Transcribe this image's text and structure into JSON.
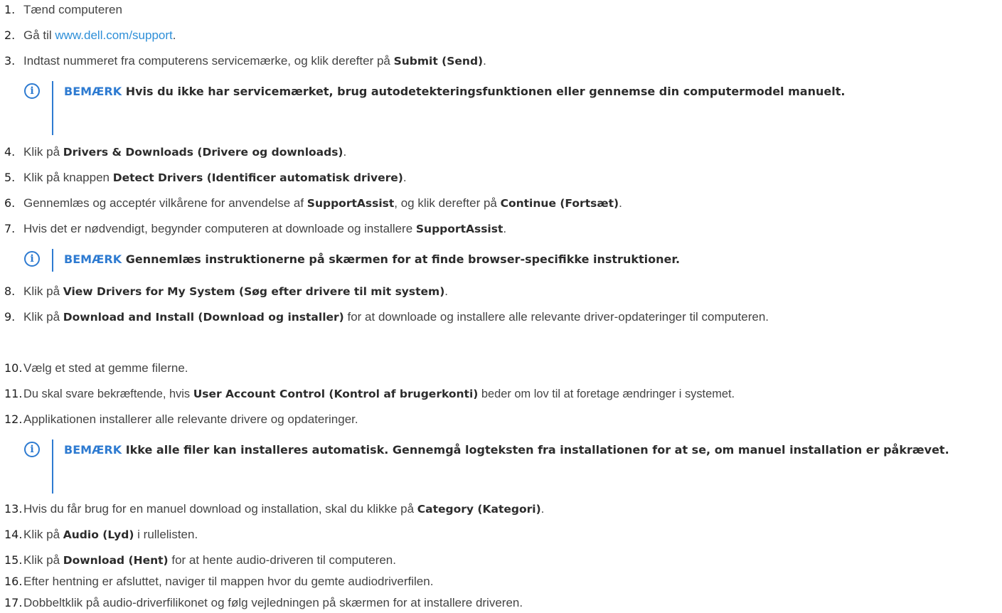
{
  "steps": [
    {
      "num": "1.",
      "parts": [
        {
          "t": "Tænd computeren"
        }
      ]
    },
    {
      "num": "2.",
      "parts": [
        {
          "t": "Gå til "
        },
        {
          "t": "www.dell.com/support",
          "link": true
        },
        {
          "t": "."
        }
      ]
    },
    {
      "num": "3.",
      "parts": [
        {
          "t": "Indtast nummeret fra computerens servicemærke, og klik derefter på "
        },
        {
          "t": "Submit (Send)",
          "b": true
        },
        {
          "t": "."
        }
      ]
    },
    {
      "num": "4.",
      "parts": [
        {
          "t": "Klik på "
        },
        {
          "t": "Drivers & Downloads (Drivere og downloads)",
          "b": true
        },
        {
          "t": "."
        }
      ]
    },
    {
      "num": "5.",
      "parts": [
        {
          "t": "Klik på knappen "
        },
        {
          "t": "Detect Drivers (Identificer automatisk drivere)",
          "b": true
        },
        {
          "t": "."
        }
      ]
    },
    {
      "num": "6.",
      "parts": [
        {
          "t": "Gennemlæs og acceptér vilkårene for anvendelse af "
        },
        {
          "t": "SupportAssist",
          "b": true
        },
        {
          "t": ", og klik derefter på "
        },
        {
          "t": "Continue (Fortsæt)",
          "b": true
        },
        {
          "t": "."
        }
      ]
    },
    {
      "num": "7.",
      "parts": [
        {
          "t": "Hvis det er nødvendigt, begynder computeren at downloade og installere "
        },
        {
          "t": "SupportAssist",
          "b": true
        },
        {
          "t": "."
        }
      ]
    },
    {
      "num": "8.",
      "parts": [
        {
          "t": "Klik på "
        },
        {
          "t": "View Drivers for My System (Søg efter drivere til mit system)",
          "b": true
        },
        {
          "t": "."
        }
      ]
    },
    {
      "num": "9.",
      "parts": [
        {
          "t": "Klik på "
        },
        {
          "t": "Download and Install (Download og installer)",
          "b": true
        },
        {
          "t": " for at downloade og installere alle relevante driver-opdateringer til computeren."
        }
      ]
    },
    {
      "num": "10.",
      "parts": [
        {
          "t": "Vælg et sted at gemme filerne."
        }
      ]
    },
    {
      "num": "11.",
      "parts": [
        {
          "t": "Du skal svare bekræftende, hvis "
        },
        {
          "t": "User Account Control (Kontrol af brugerkonti)",
          "b": true
        },
        {
          "t": " beder om lov til at foretage ændringer i systemet."
        }
      ]
    },
    {
      "num": "12.",
      "parts": [
        {
          "t": "Applikationen installerer alle relevante drivere og opdateringer."
        }
      ]
    },
    {
      "num": "13.",
      "parts": [
        {
          "t": "Hvis du får brug for en manuel download og installation, skal du klikke på "
        },
        {
          "t": "Category (Kategori)",
          "b": true
        },
        {
          "t": "."
        }
      ]
    },
    {
      "num": "14.",
      "parts": [
        {
          "t": "Klik på "
        },
        {
          "t": "Audio (Lyd)",
          "b": true
        },
        {
          "t": " i rullelisten."
        }
      ]
    },
    {
      "num": "15.",
      "parts": [
        {
          "t": "Klik på "
        },
        {
          "t": "Download (Hent)",
          "b": true
        },
        {
          "t": " for at hente audio-driveren til computeren."
        }
      ]
    },
    {
      "num": "16.",
      "parts": [
        {
          "t": "Efter hentning er afsluttet, naviger til mappen hvor du gemte audiodriverfilen."
        }
      ]
    },
    {
      "num": "17.",
      "parts": [
        {
          "t": "Dobbeltklik på audio-driverfilikonet og følg vejledningen på skærmen for at installere driveren."
        }
      ]
    }
  ],
  "notes": [
    {
      "icon": "i",
      "label": "BEMÆRK",
      "text": "Hvis du ikke har servicemærket, brug autodetekteringsfunktionen eller gennemse din computermodel manuelt."
    },
    {
      "icon": "i",
      "label": "BEMÆRK",
      "text": "Gennemlæs instruktionerne på skærmen for at finde browser-specifikke instruktioner."
    },
    {
      "icon": "i",
      "label": "BEMÆRK",
      "text": "Ikke alle filer kan installeres automatisk. Gennemgå logteksten fra installationen for at se, om manuel installation er påkrævet."
    }
  ]
}
